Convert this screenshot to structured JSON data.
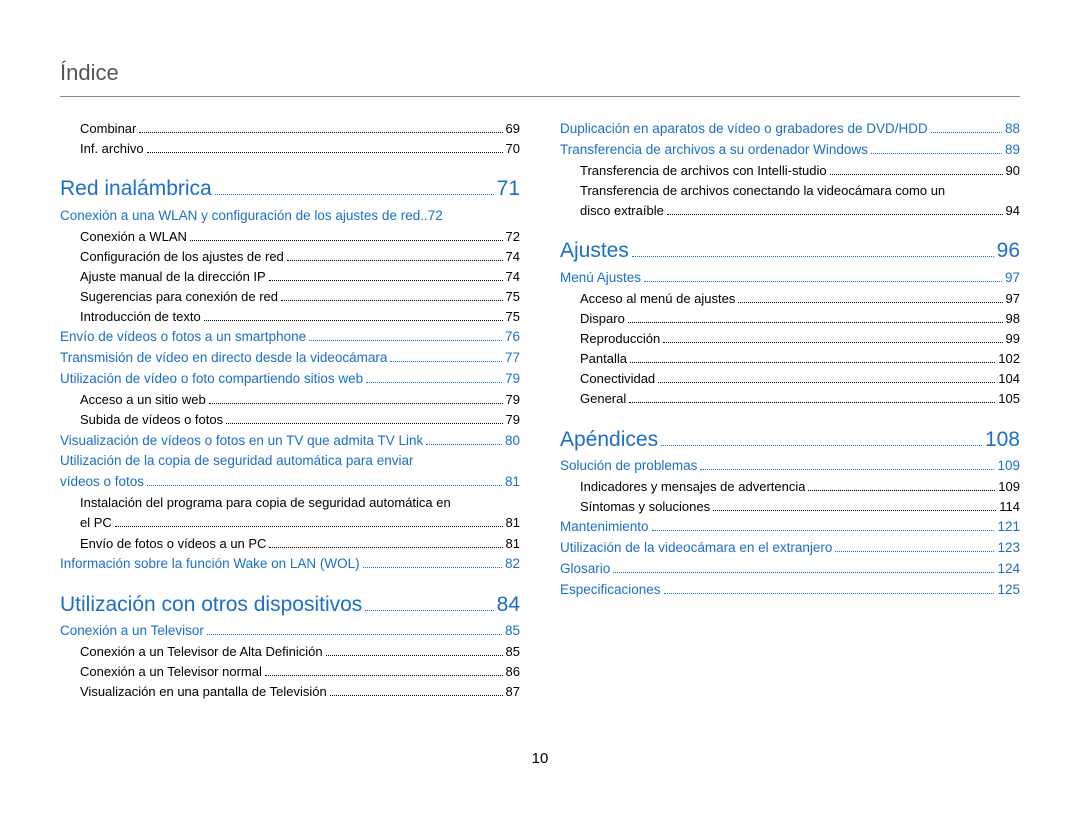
{
  "title": "Índice",
  "pageNumber": "10",
  "left": [
    {
      "t": "sub",
      "label": "Combinar",
      "page": "69"
    },
    {
      "t": "sub",
      "label": "Inf. archivo",
      "page": "70"
    },
    {
      "t": "chapter",
      "label": "Red inalámbrica",
      "page": "71"
    },
    {
      "t": "section",
      "label": "Conexión a una WLAN y configuración de los ajustes de red",
      "page": "72",
      "nodots": true
    },
    {
      "t": "sub",
      "label": "Conexión a WLAN",
      "page": "72"
    },
    {
      "t": "sub",
      "label": "Configuración de los ajustes de red",
      "page": "74"
    },
    {
      "t": "sub",
      "label": "Ajuste manual de la dirección IP",
      "page": "74"
    },
    {
      "t": "sub",
      "label": "Sugerencias para conexión de red",
      "page": "75"
    },
    {
      "t": "sub",
      "label": "Introducción de texto",
      "page": "75"
    },
    {
      "t": "section",
      "label": "Envío de vídeos o fotos a un smartphone",
      "page": "76"
    },
    {
      "t": "section",
      "label": "Transmisión de vídeo en directo desde la videocámara",
      "page": "77"
    },
    {
      "t": "section",
      "label": "Utilización de vídeo o foto compartiendo sitios web",
      "page": "79"
    },
    {
      "t": "sub",
      "label": "Acceso a un sitio web",
      "page": "79"
    },
    {
      "t": "sub",
      "label": "Subida de vídeos o fotos",
      "page": "79"
    },
    {
      "t": "section",
      "label": "Visualización de vídeos o fotos en un TV que admita TV Link",
      "page": "80"
    },
    {
      "t": "sectionmulti",
      "label1": "Utilización de la copia de seguridad automática para enviar",
      "label2": "vídeos o fotos",
      "page": "81"
    },
    {
      "t": "submulti",
      "label1": "Instalación del programa para copia de seguridad automática en",
      "label2": "el PC",
      "page": "81"
    },
    {
      "t": "sub",
      "label": "Envío de fotos o vídeos a un PC",
      "page": "81"
    },
    {
      "t": "section",
      "label": "Información sobre la función Wake on LAN (WOL)",
      "page": "82"
    },
    {
      "t": "chapter",
      "label": "Utilización con otros dispositivos",
      "page": "84"
    },
    {
      "t": "section",
      "label": "Conexión a un Televisor",
      "page": "85"
    },
    {
      "t": "sub",
      "label": "Conexión a un Televisor de Alta Definición",
      "page": "85"
    },
    {
      "t": "sub",
      "label": "Conexión a un Televisor normal",
      "page": "86"
    },
    {
      "t": "sub",
      "label": "Visualización en una pantalla de Televisión",
      "page": "87"
    }
  ],
  "right": [
    {
      "t": "section",
      "label": "Duplicación en aparatos de vídeo o grabadores de DVD/HDD",
      "page": "88"
    },
    {
      "t": "section",
      "label": "Transferencia de archivos a su ordenador Windows",
      "page": "89"
    },
    {
      "t": "sub",
      "label": "Transferencia de archivos con Intelli-studio",
      "page": "90"
    },
    {
      "t": "submulti",
      "label1": "Transferencia de archivos conectando la videocámara como un",
      "label2": "disco extraíble",
      "page": "94"
    },
    {
      "t": "chapter",
      "label": "Ajustes",
      "page": "96"
    },
    {
      "t": "section",
      "label": "Menú Ajustes",
      "page": "97"
    },
    {
      "t": "sub",
      "label": "Acceso al menú de ajustes",
      "page": "97"
    },
    {
      "t": "sub",
      "label": "Disparo",
      "page": "98"
    },
    {
      "t": "sub",
      "label": "Reproducción",
      "page": "99"
    },
    {
      "t": "sub",
      "label": "Pantalla",
      "page": "102"
    },
    {
      "t": "sub",
      "label": "Conectividad",
      "page": "104"
    },
    {
      "t": "sub",
      "label": "General",
      "page": "105"
    },
    {
      "t": "chapter",
      "label": "Apéndices",
      "page": "108"
    },
    {
      "t": "section",
      "label": "Solución de problemas",
      "page": "109"
    },
    {
      "t": "sub",
      "label": "Indicadores y mensajes de advertencia",
      "page": "109"
    },
    {
      "t": "sub",
      "label": "Síntomas y soluciones",
      "page": "114"
    },
    {
      "t": "section",
      "label": "Mantenimiento",
      "page": "121"
    },
    {
      "t": "section",
      "label": "Utilización de la videocámara en el extranjero",
      "page": "123"
    },
    {
      "t": "section",
      "label": "Glosario",
      "page": "124"
    },
    {
      "t": "section",
      "label": "Especificaciones",
      "page": "125"
    }
  ]
}
